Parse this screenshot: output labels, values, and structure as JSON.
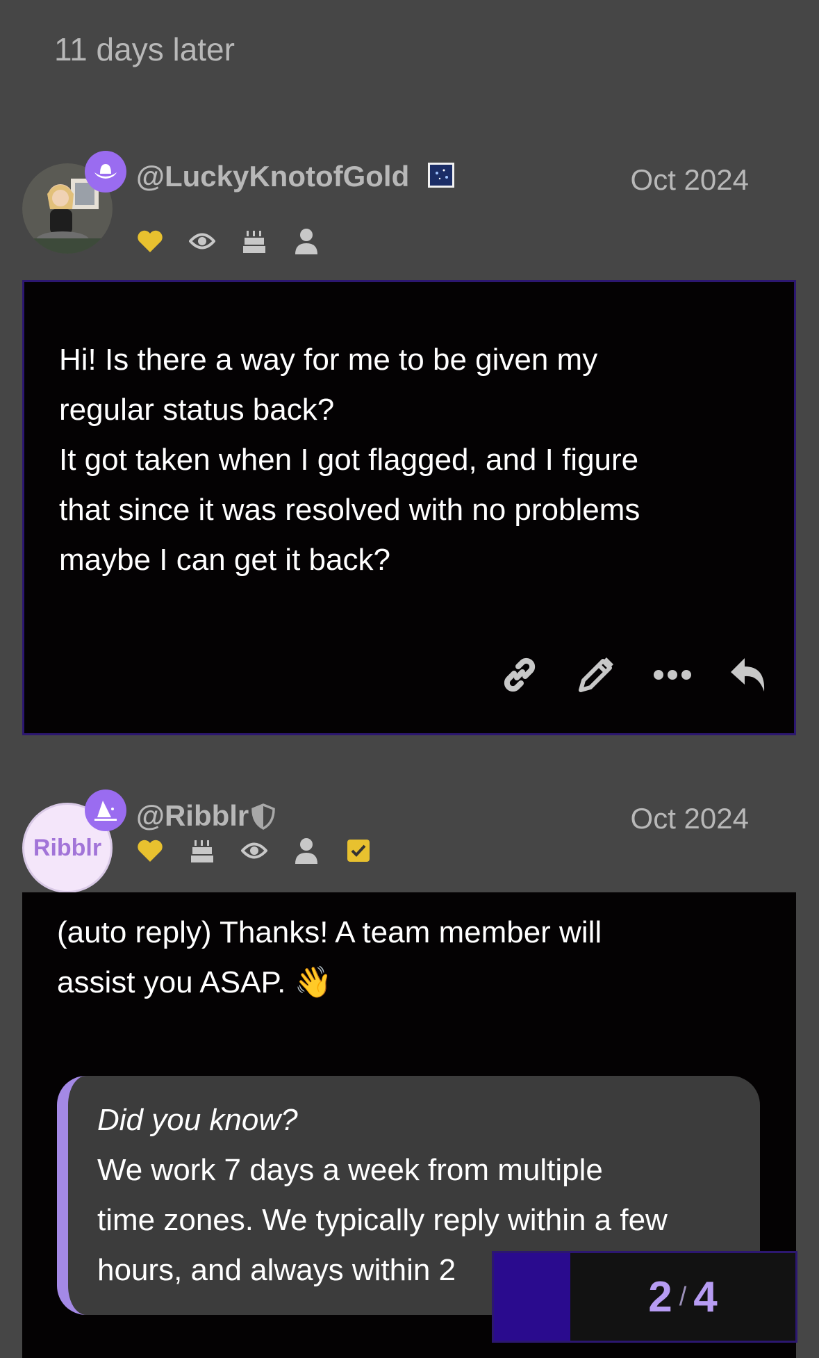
{
  "time_gap": "11 days later",
  "posts": [
    {
      "username": "@LuckyKnotofGold",
      "date": "Oct 2024",
      "flair_icons": [
        "heart-icon",
        "eye-icon",
        "cake-icon",
        "user-icon"
      ],
      "title_badge_icon": "cowboy-hat-icon",
      "text_lines": [
        "Hi! Is there a way for me to be given my",
        "regular status back?",
        "It got taken when I got flagged, and I figure",
        "that since it was resolved with no problems",
        "maybe I can get it back?"
      ],
      "actions": [
        "link-icon",
        "edit-icon",
        "more-icon",
        "reply-icon"
      ]
    },
    {
      "username": "@Ribblr",
      "avatar_text": "Ribblr",
      "date": "Oct 2024",
      "title_badge_icon": "wizard-hat-icon",
      "flair_icons": [
        "heart-icon",
        "cake-icon",
        "eye-icon",
        "user-icon",
        "checkbox-icon"
      ],
      "text_lines": [
        "(auto reply) Thanks! A team member will",
        "assist you ASAP. 👋"
      ],
      "callout": {
        "title": "Did you know?",
        "lines": [
          "We work 7 days a week from multiple",
          "time zones. We typically reply within a few",
          "hours, and always within 2"
        ]
      }
    }
  ],
  "progress": {
    "current": "2",
    "separator": "/",
    "total": "4"
  },
  "colors": {
    "background": "#464646",
    "post_bg": "#040203",
    "accent": "#9a6cf0",
    "heart": "#e8c12f"
  }
}
